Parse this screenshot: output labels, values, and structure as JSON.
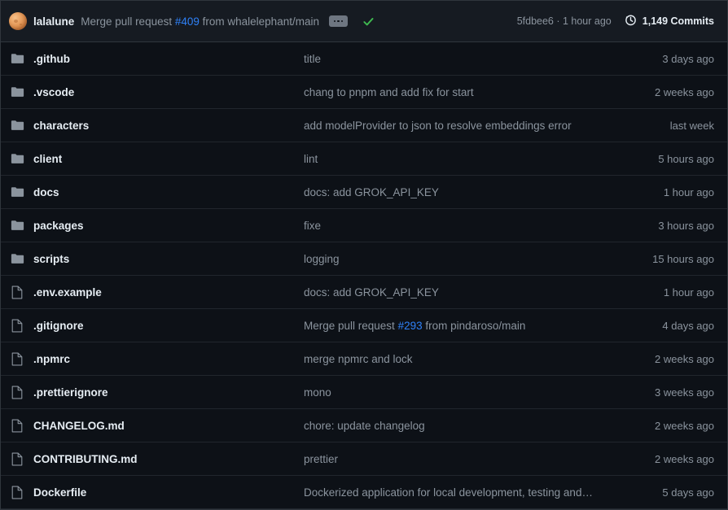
{
  "commit_bar": {
    "avatar_name": "lalalune-avatar",
    "author": "lalalune",
    "message_prefix": "Merge pull request ",
    "pr_number": "#409",
    "message_suffix": " from whalelephant/main",
    "expand_button_label": "",
    "status_icon": "check-icon",
    "commit_hash_and_time": "5fdbee6 · 1 hour ago",
    "commits_icon": "history-icon",
    "commits_count": "1,149 Commits"
  },
  "colors": {
    "background": "#0d1117",
    "header_background": "#161b22",
    "border": "#30363d",
    "row_border": "#21262d",
    "text_primary": "#e6edf3",
    "text_muted": "#8b949e",
    "link": "#2f81f7",
    "folder_icon": "#8b949e",
    "file_icon": "#8b949e",
    "check_green": "#3fb950"
  },
  "files": [
    {
      "type": "folder",
      "name": ".github",
      "message": "title",
      "pr": null,
      "message_prefix": null,
      "message_suffix": null,
      "time": "3 days ago"
    },
    {
      "type": "folder",
      "name": ".vscode",
      "message": "chang to pnpm and add fix for start",
      "pr": null,
      "message_prefix": null,
      "message_suffix": null,
      "time": "2 weeks ago"
    },
    {
      "type": "folder",
      "name": "characters",
      "message": "add modelProvider to json to resolve embeddings error",
      "pr": null,
      "message_prefix": null,
      "message_suffix": null,
      "time": "last week"
    },
    {
      "type": "folder",
      "name": "client",
      "message": "lint",
      "pr": null,
      "message_prefix": null,
      "message_suffix": null,
      "time": "5 hours ago"
    },
    {
      "type": "folder",
      "name": "docs",
      "message": "docs: add GROK_API_KEY",
      "pr": null,
      "message_prefix": null,
      "message_suffix": null,
      "time": "1 hour ago"
    },
    {
      "type": "folder",
      "name": "packages",
      "message": "fixe",
      "pr": null,
      "message_prefix": null,
      "message_suffix": null,
      "time": "3 hours ago"
    },
    {
      "type": "folder",
      "name": "scripts",
      "message": "logging",
      "pr": null,
      "message_prefix": null,
      "message_suffix": null,
      "time": "15 hours ago"
    },
    {
      "type": "file",
      "name": ".env.example",
      "message": "docs: add GROK_API_KEY",
      "pr": null,
      "message_prefix": null,
      "message_suffix": null,
      "time": "1 hour ago"
    },
    {
      "type": "file",
      "name": ".gitignore",
      "message": null,
      "message_prefix": "Merge pull request ",
      "pr": "#293",
      "message_suffix": " from pindaroso/main",
      "time": "4 days ago"
    },
    {
      "type": "file",
      "name": ".npmrc",
      "message": "merge npmrc and lock",
      "pr": null,
      "message_prefix": null,
      "message_suffix": null,
      "time": "2 weeks ago"
    },
    {
      "type": "file",
      "name": ".prettierignore",
      "message": "mono",
      "pr": null,
      "message_prefix": null,
      "message_suffix": null,
      "time": "3 weeks ago"
    },
    {
      "type": "file",
      "name": "CHANGELOG.md",
      "message": "chore: update changelog",
      "pr": null,
      "message_prefix": null,
      "message_suffix": null,
      "time": "2 weeks ago"
    },
    {
      "type": "file",
      "name": "CONTRIBUTING.md",
      "message": "prettier",
      "pr": null,
      "message_prefix": null,
      "message_suffix": null,
      "time": "2 weeks ago"
    },
    {
      "type": "file",
      "name": "Dockerfile",
      "message": "Dockerized application for local development, testing and…",
      "pr": null,
      "message_prefix": null,
      "message_suffix": null,
      "time": "5 days ago"
    }
  ]
}
